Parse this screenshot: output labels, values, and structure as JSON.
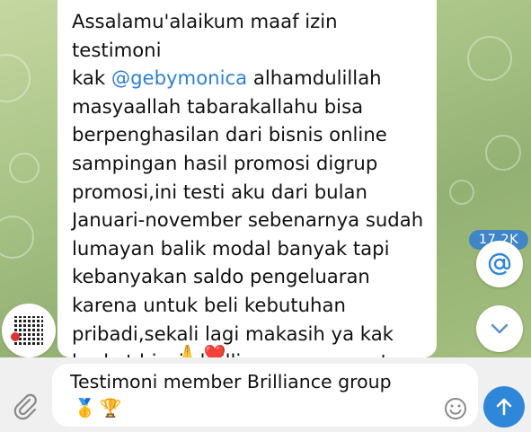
{
  "message": {
    "lines_before_mention": "Assalamu'alaikum maaf izin testimoni\nkak ",
    "mention": "@gebymonica",
    "lines_after_mention": " alhamdulillah\nmasyaallah tabarakallahu bisa\nberpenghasilan dari bisnis online\nsampingan hasil promosi digrup\npromosi,ini testi aku dari bulan\nJanuari-november sebenarnya sudah\nlumayan balik modal banyak tapi\nkebanyakan saldo pengeluaran\nkarena untuk beli kebutuhan\npribadi,sekali lagi makasih ya kak\nberkat bisnis brilliance,semangat",
    "trailing_emojis": "🙏❤️"
  },
  "channel": {
    "views": "17.2K"
  },
  "composer": {
    "text": "Testimoni member Brilliance group",
    "emojis": "🥇🏆"
  },
  "colors": {
    "accent": "#2f87d9",
    "mention": "#2d7fd3",
    "badge": "#3f86c8"
  },
  "icons": {
    "attach": "paperclip-icon",
    "emoji": "smile-icon",
    "send": "arrow-up-icon",
    "mention": "at-sign-icon",
    "scroll_down": "chevron-down-icon"
  }
}
